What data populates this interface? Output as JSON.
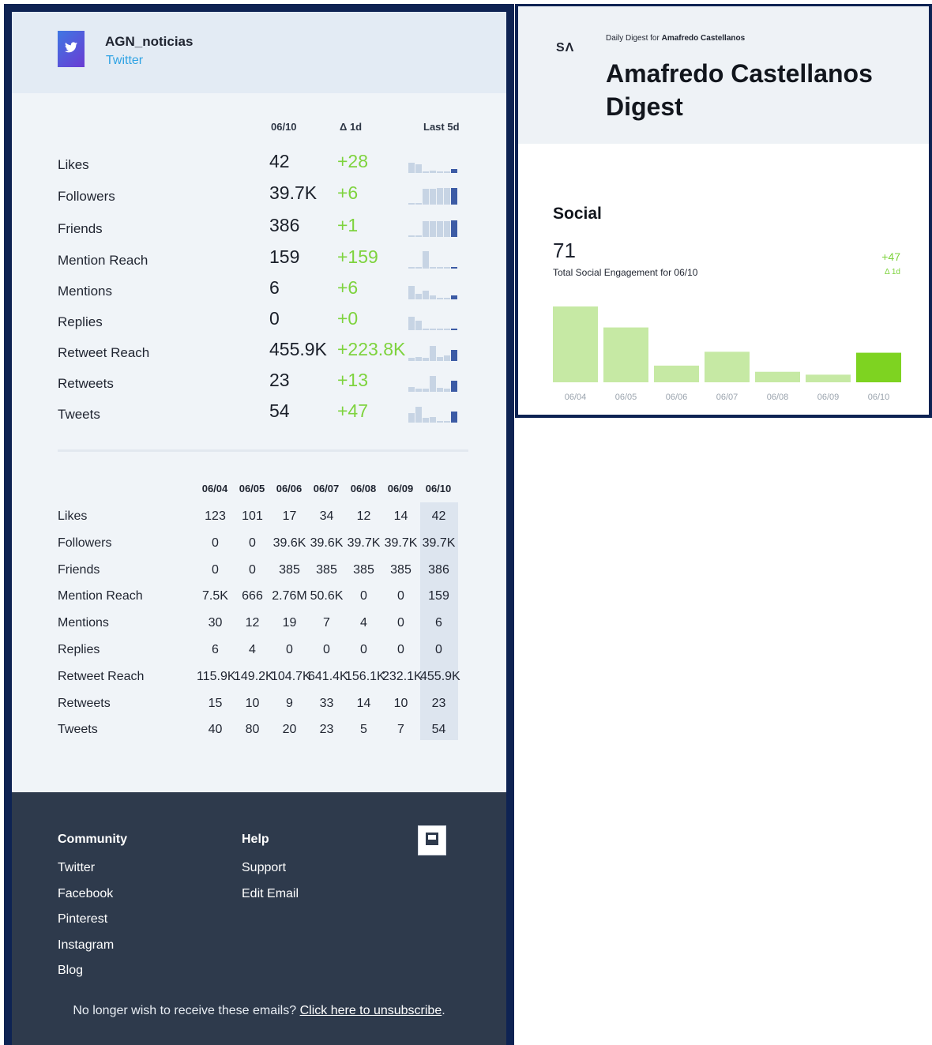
{
  "account": {
    "name": "AGN_noticias",
    "network": "Twitter"
  },
  "summary": {
    "col_date": "06/10",
    "col_delta": "Δ 1d",
    "col_trend": "Last 5d",
    "rows": [
      {
        "label": "Likes",
        "value": "42",
        "delta": "+28",
        "trend": [
          0.55,
          0.45,
          0.08,
          0.12,
          0.05,
          0.05,
          0.2
        ]
      },
      {
        "label": "Followers",
        "value": "39.7K",
        "delta": "+6",
        "trend": [
          0.02,
          0.02,
          0.85,
          0.85,
          0.86,
          0.86,
          0.86
        ]
      },
      {
        "label": "Friends",
        "value": "386",
        "delta": "+1",
        "trend": [
          0.02,
          0.02,
          0.85,
          0.85,
          0.85,
          0.85,
          0.86
        ]
      },
      {
        "label": "Mention Reach",
        "value": "159",
        "delta": "+159",
        "trend": [
          0.03,
          0.02,
          0.9,
          0.04,
          0.02,
          0.02,
          0.03
        ]
      },
      {
        "label": "Mentions",
        "value": "6",
        "delta": "+6",
        "trend": [
          0.7,
          0.3,
          0.45,
          0.2,
          0.1,
          0.02,
          0.2
        ]
      },
      {
        "label": "Replies",
        "value": "0",
        "delta": "+0",
        "trend": [
          0.7,
          0.5,
          0.05,
          0.05,
          0.05,
          0.05,
          0.05
        ]
      },
      {
        "label": "Retweet Reach",
        "value": "455.9K",
        "delta": "+223.8K",
        "trend": [
          0.15,
          0.2,
          0.15,
          0.8,
          0.2,
          0.3,
          0.6
        ]
      },
      {
        "label": "Retweets",
        "value": "23",
        "delta": "+13",
        "trend": [
          0.25,
          0.15,
          0.15,
          0.85,
          0.2,
          0.15,
          0.6
        ]
      },
      {
        "label": "Tweets",
        "value": "54",
        "delta": "+47",
        "trend": [
          0.5,
          0.85,
          0.25,
          0.3,
          0.08,
          0.1,
          0.6
        ]
      }
    ]
  },
  "history": {
    "dates": [
      "06/04",
      "06/05",
      "06/06",
      "06/07",
      "06/08",
      "06/09",
      "06/10"
    ],
    "rows": [
      {
        "label": "Likes",
        "cells": [
          "123",
          "101",
          "17",
          "34",
          "12",
          "14",
          "42"
        ]
      },
      {
        "label": "Followers",
        "cells": [
          "0",
          "0",
          "39.6K",
          "39.6K",
          "39.7K",
          "39.7K",
          "39.7K"
        ]
      },
      {
        "label": "Friends",
        "cells": [
          "0",
          "0",
          "385",
          "385",
          "385",
          "385",
          "386"
        ]
      },
      {
        "label": "Mention Reach",
        "cells": [
          "7.5K",
          "666",
          "2.76M",
          "50.6K",
          "0",
          "0",
          "159"
        ]
      },
      {
        "label": "Mentions",
        "cells": [
          "30",
          "12",
          "19",
          "7",
          "4",
          "0",
          "6"
        ]
      },
      {
        "label": "Replies",
        "cells": [
          "6",
          "4",
          "0",
          "0",
          "0",
          "0",
          "0"
        ]
      },
      {
        "label": "Retweet Reach",
        "cells": [
          "115.9K",
          "149.2K",
          "104.7K",
          "641.4K",
          "156.1K",
          "232.1K",
          "455.9K"
        ]
      },
      {
        "label": "Retweets",
        "cells": [
          "15",
          "10",
          "9",
          "33",
          "14",
          "10",
          "23"
        ]
      },
      {
        "label": "Tweets",
        "cells": [
          "40",
          "80",
          "20",
          "23",
          "5",
          "7",
          "54"
        ]
      }
    ]
  },
  "footer": {
    "community_title": "Community",
    "community_links": [
      "Twitter",
      "Facebook",
      "Pinterest",
      "Instagram",
      "Blog"
    ],
    "help_title": "Help",
    "help_links": [
      "Support",
      "Edit Email"
    ],
    "brand_icon": "image-icon",
    "unsub_text": "No longer wish to receive these emails?",
    "unsub_link": "Click here to unsubscribe",
    "unsub_end": "."
  },
  "digest": {
    "logo": "SΛ",
    "kicker": "Daily Digest for",
    "kicker_name": "Amafredo Castellanos",
    "title": "Amafredo Castellanos Digest",
    "social_title": "Social",
    "total": "71",
    "caption": "Total Social Engagement for 06/10",
    "delta": "+47",
    "delta_label": "Δ 1d"
  },
  "chart_data": {
    "type": "bar",
    "categories": [
      "06/04",
      "06/05",
      "06/06",
      "06/07",
      "06/08",
      "06/09",
      "06/10"
    ],
    "values": [
      159,
      115,
      35,
      64,
      22,
      16,
      62
    ],
    "highlight_color": "#7ed321",
    "bar_color": "#c6e9a4",
    "highlight_index": 6
  },
  "colors": {
    "accent_green": "#7ed33e",
    "twitter_blue": "#2fa3e4",
    "footer_bg": "#2e3a4c",
    "frame_navy": "#0e2353"
  }
}
